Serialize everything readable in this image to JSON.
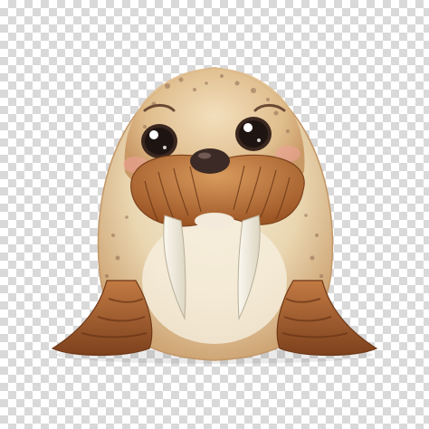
{
  "image": {
    "subject": "walrus",
    "background": "transparent-checkerboard",
    "colors": {
      "body_light": "#f1e6cd",
      "body_mid": "#e2c9a0",
      "body_shade": "#c89c68",
      "flipper": "#a5612f",
      "flipper_dark": "#7a3f1c",
      "mustache": "#b06a32",
      "mustache_light": "#d89a5c",
      "tusk": "#f3efe4",
      "nose": "#3b2a25",
      "eye": "#2a1d19",
      "cheek": "#f0a39a",
      "spots": "#8f6a52"
    }
  }
}
